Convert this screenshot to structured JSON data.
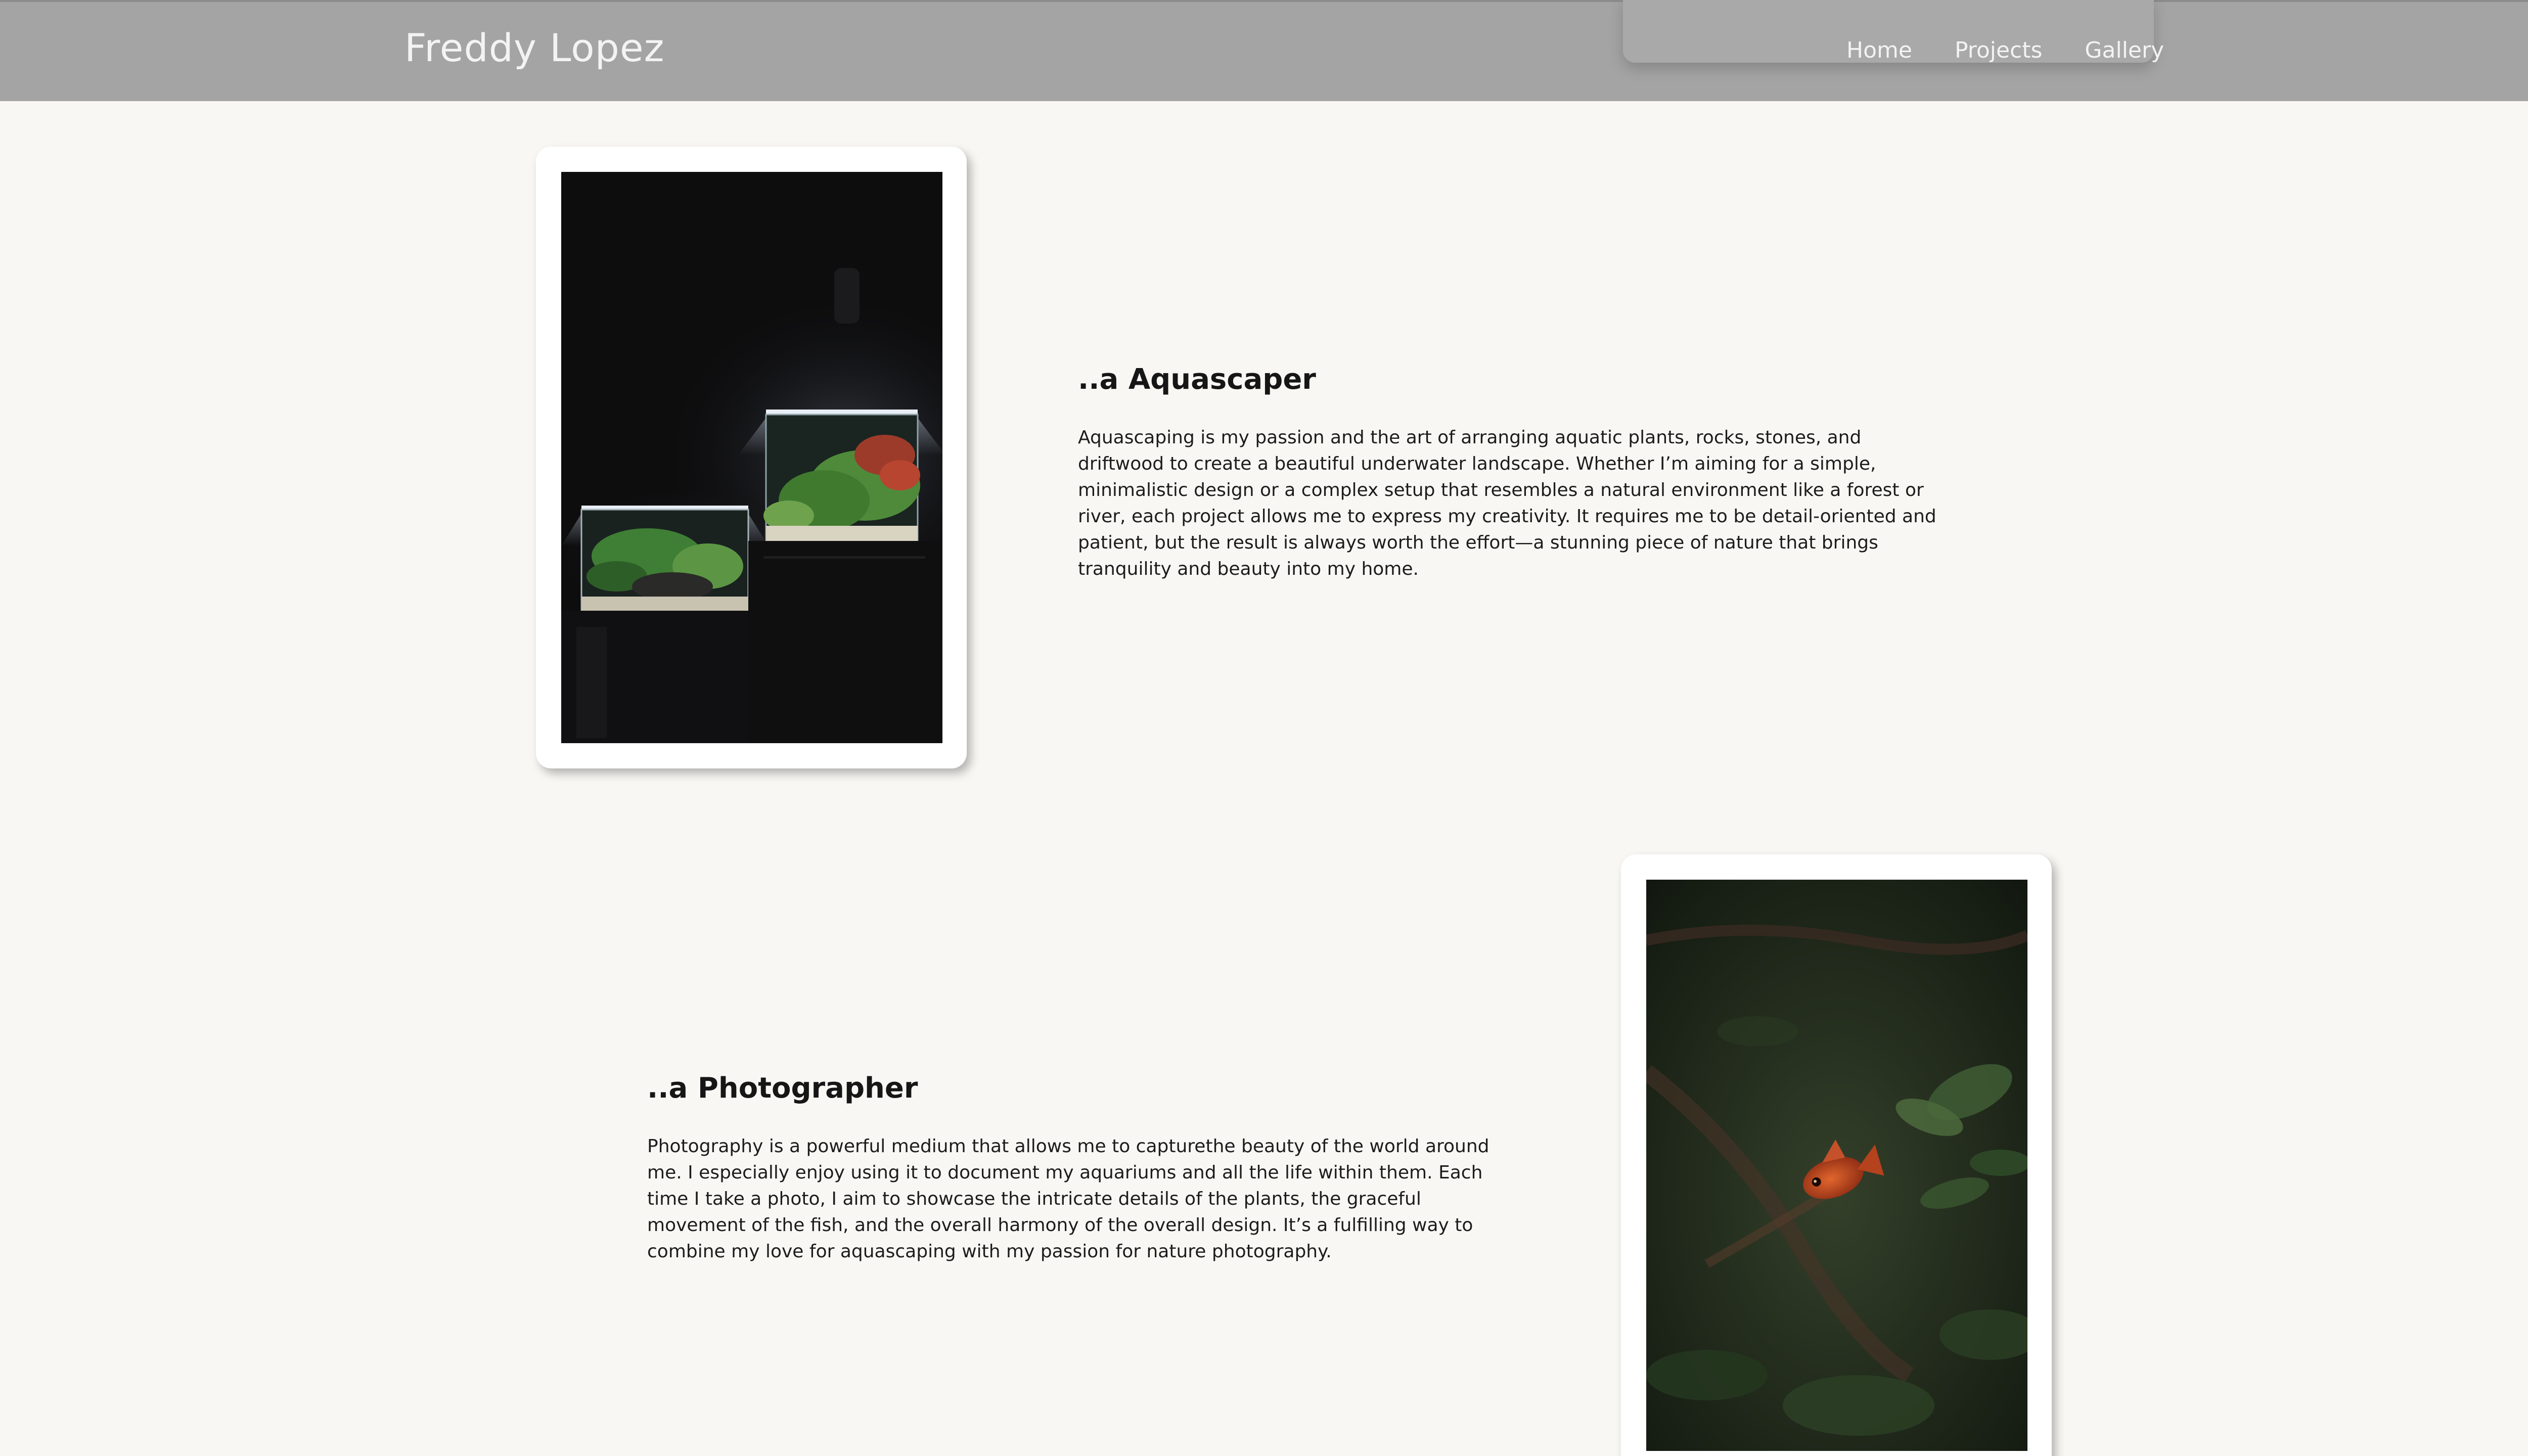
{
  "header": {
    "brand": "Freddy Lopez",
    "nav": [
      "Home",
      "Projects",
      "Gallery"
    ]
  },
  "sections": [
    {
      "title": "..a Aquascaper",
      "text": "Aquascaping is my passion and the art of arranging aquatic plants, rocks, stones, and driftwood to create a beautiful underwater landscape. Whether I’m aiming for a simple, minimalistic design or a complex setup that resembles a natural environment like a forest or river, each project allows me to express my creativity. It requires me to be detail-oriented and patient, but the result is always worth the effort—a stunning piece of nature that brings tranquility and beauty into my home.",
      "image": "aquarium-tanks-photo"
    },
    {
      "title": "..a Photographer",
      "text": "Photography is a powerful medium that allows me to capturethe beauty of the world around me. I especially enjoy using it to document my aquariums and all the life within them. Each time I take a photo, I aim to showcase the intricate details of the plants, the graceful movement of the fish, and the overall harmony of the overall design. It’s a fulfilling way to combine my love for aquascaping with my passion for nature photography.",
      "image": "red-fish-photo"
    }
  ],
  "colors": {
    "background": "#f8f7f3",
    "header": "#a4a4a4",
    "header_text": "#f3f3f3",
    "body_text": "#1c1c1c"
  },
  "icons": {
    "floating_button": "color-picker-icon"
  }
}
